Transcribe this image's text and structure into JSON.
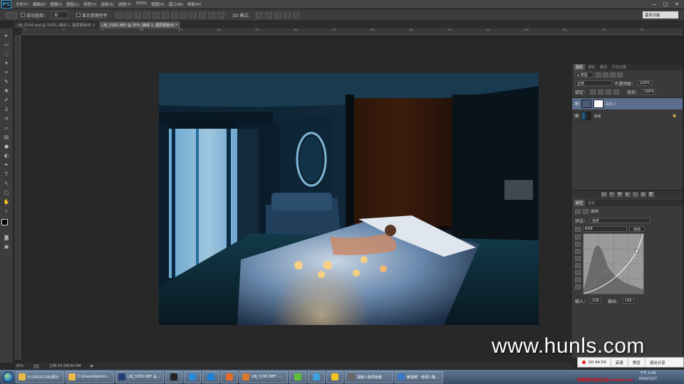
{
  "app": {
    "logo": "PS",
    "menu": [
      "文件(F)",
      "编辑(E)",
      "图像(I)",
      "图层(L)",
      "类型(Y)",
      "选择(S)",
      "滤镜(T)",
      "3D(D)",
      "视图(V)",
      "窗口(W)",
      "帮助(H)"
    ],
    "window_controls": [
      "—",
      "□",
      "✕"
    ]
  },
  "options": {
    "auto_select_label": "自动选择：",
    "auto_select_value": "组",
    "show_transform_label": "显示变换控件",
    "mode_3d_label": "3D 模式：",
    "workspace": "基本功能"
  },
  "tabs": [
    {
      "label": "LBJ_5144.psd @ 100% (曲线 1, 图层蒙版/8) ×",
      "active": false
    },
    {
      "label": "LBJ_5165.NEF @ 25% (曲线 1, 图层蒙版/8) *",
      "active": true
    }
  ],
  "ruler": {
    "top": [
      "5",
      "0",
      "5",
      "10",
      "15",
      "20",
      "25",
      "30",
      "35",
      "40",
      "45",
      "50",
      "55",
      "60",
      "65",
      "70",
      "75"
    ]
  },
  "layers_panel": {
    "tabs": [
      "图层",
      "通道",
      "路径",
      "历史记录"
    ],
    "kind": "ρ 类型",
    "blend_mode": "正常",
    "opacity_label": "不透明度：",
    "opacity_value": "100%",
    "lock_label": "锁定：",
    "fill_label": "填充：",
    "fill_value": "100%",
    "layers": [
      {
        "name": "曲线 1",
        "selected": true
      },
      {
        "name": "背景",
        "selected": false
      }
    ],
    "footer_icons": [
      "ɡɑ",
      "fx",
      "◘",
      "◐",
      "▭",
      "▤",
      "🗑"
    ]
  },
  "properties_panel": {
    "tabs": [
      "属性",
      "信息"
    ],
    "title": "曲线",
    "preset_label": "预设：",
    "preset_value": "自定",
    "channel_value": "RGB",
    "auto_label": "自动",
    "input_label": "输入：",
    "input_value": "228",
    "output_label": "输出：",
    "output_value": "193"
  },
  "status": {
    "zoom": "25%",
    "doc": "文档:34.5M/34.5M"
  },
  "taskbar": {
    "items": [
      {
        "label": "E:\\20151126\\照片",
        "icon": "#e8b84a"
      },
      {
        "label": "C:\\Users\\Admini...",
        "icon": "#e8b84a"
      },
      {
        "label": "LBJ_5165.NEF @...",
        "icon": "#1f3f73"
      },
      {
        "label": "",
        "icon": "#222"
      },
      {
        "label": "",
        "icon": "#2a8ad8"
      },
      {
        "label": "",
        "icon": "#1e7fd6"
      },
      {
        "label": "",
        "icon": "#e46a2a"
      },
      {
        "label": "LBJ_5165.NEF - ...",
        "icon": "#d97a2e"
      },
      {
        "label": "",
        "icon": "#5fbf3b"
      },
      {
        "label": "",
        "icon": "#3fa0de"
      },
      {
        "label": "",
        "icon": "#f2c520"
      },
      {
        "label": "黑暗人像调色教...",
        "icon": "#666"
      },
      {
        "label": "教视频：暗调人像...",
        "icon": "#3a78c6"
      }
    ],
    "time": "下午 1:43",
    "date": "2016/12/7"
  },
  "recorder": {
    "time": "00:44:59",
    "buttons": [
      "高清",
      "预览",
      "退出分享"
    ]
  },
  "watermark": "www.hunls.com",
  "promo_text": "屏幕录像专家未注册 tlxsoft.com"
}
